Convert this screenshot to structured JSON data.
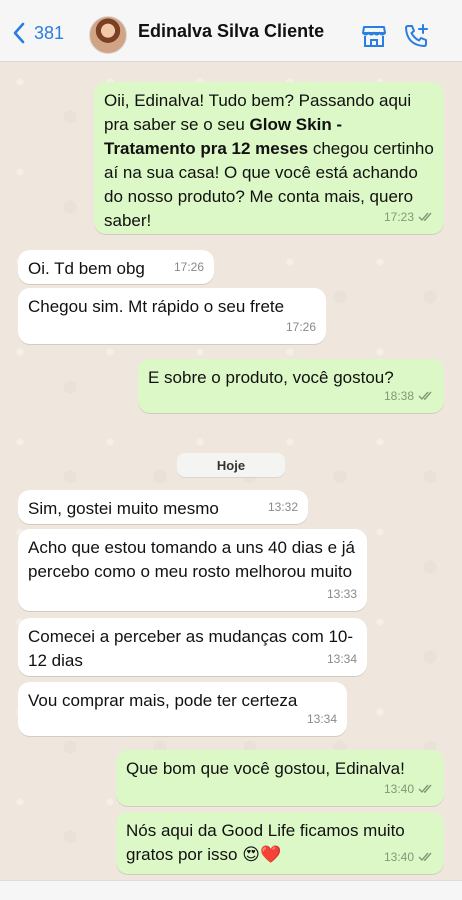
{
  "header": {
    "back_count": "381",
    "contact_name": "Edinalva Silva Cliente",
    "icons": [
      "chevron-left-icon",
      "store-icon",
      "phone-plus-icon"
    ],
    "accent_color": "#2a7de1"
  },
  "messages": [
    {
      "direction": "out",
      "text_before": "Oii, Edinalva! Tudo bem? Passando aqui pra saber se o seu ",
      "text_bold": "Glow Skin - Tratamento pra 12 meses",
      "text_after": " chegou certinho aí na sua casa! O que você está achando do nosso produto? Me conta mais, quero saber!",
      "time": "17:23",
      "read": true
    },
    {
      "direction": "in",
      "text": "Oi. Td bem obg",
      "time": "17:26"
    },
    {
      "direction": "in",
      "text": "Chegou sim. Mt rápido o seu frete",
      "time": "17:26"
    },
    {
      "direction": "out",
      "text": "E sobre o produto, você gostou?",
      "time": "18:38",
      "read": true
    },
    {
      "direction": "in",
      "text": "Sim, gostei muito mesmo",
      "time": "13:32"
    },
    {
      "direction": "in",
      "text": "Acho que estou tomando a uns 40 dias e já percebo como o meu rosto melhorou muito",
      "time": "13:33"
    },
    {
      "direction": "in",
      "text": "Comecei a perceber as mudanças com 10-12 dias",
      "time": "13:34"
    },
    {
      "direction": "in",
      "text": "Vou comprar mais, pode ter certeza",
      "time": "13:34"
    },
    {
      "direction": "out",
      "text": "Que bom que você gostou, Edinalva!",
      "time": "13:40",
      "read": true
    },
    {
      "direction": "out",
      "text": "Nós aqui da Good Life ficamos muito gratos por isso 😍❤️",
      "time": "13:40",
      "read": true
    }
  ],
  "date_separator": "Hoje",
  "colors": {
    "incoming_bubble": "#ffffff",
    "outgoing_bubble": "#dcf8c6",
    "read_ticks": "#7f9a7a",
    "chat_background": "#efe7dd"
  }
}
